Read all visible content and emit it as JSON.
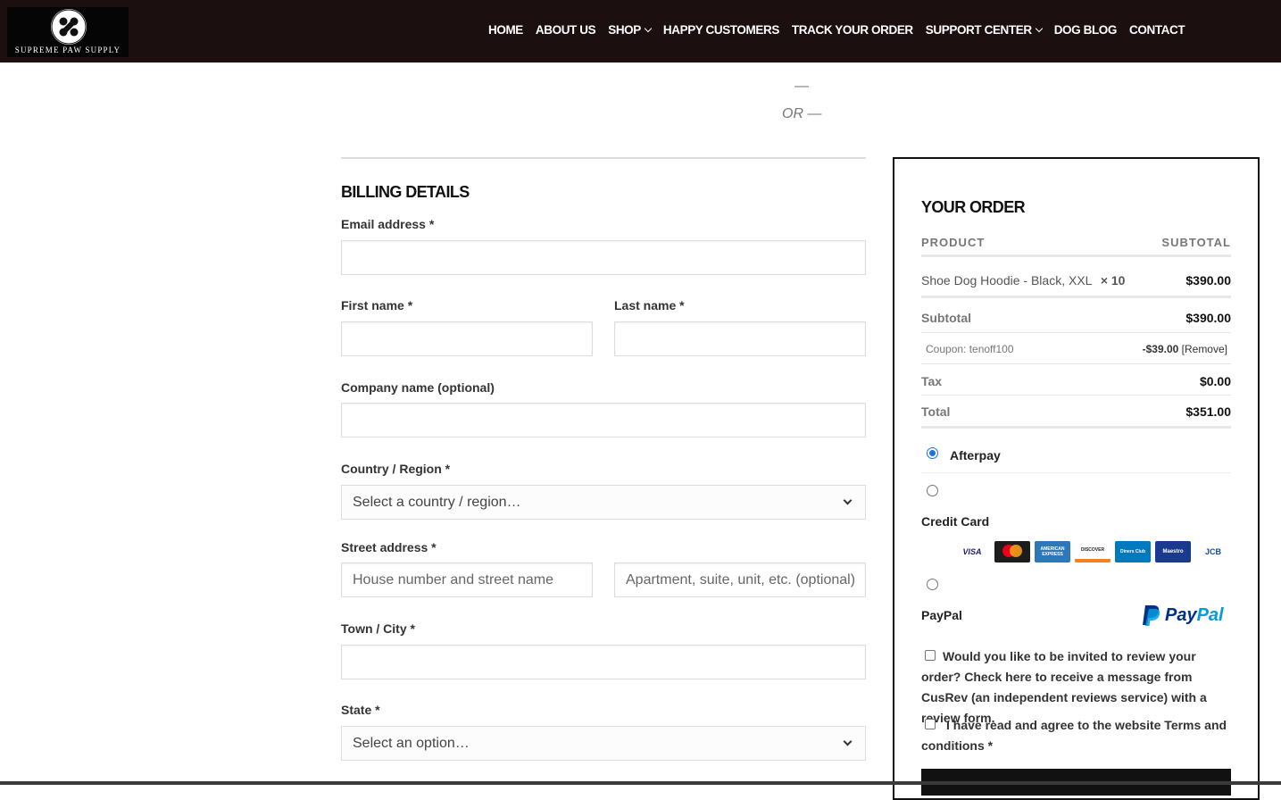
{
  "brand": {
    "name": "SUPREME PAW SUPPLY"
  },
  "nav": [
    {
      "label": "HOME",
      "dropdown": false
    },
    {
      "label": "ABOUT US",
      "dropdown": false
    },
    {
      "label": "SHOP",
      "dropdown": true
    },
    {
      "label": "HAPPY CUSTOMERS",
      "dropdown": false
    },
    {
      "label": "TRACK YOUR ORDER",
      "dropdown": false
    },
    {
      "label": "SUPPORT CENTER",
      "dropdown": true
    },
    {
      "label": "DOG BLOG",
      "dropdown": false
    },
    {
      "label": "CONTACT",
      "dropdown": false
    }
  ],
  "divider": {
    "dash": "—",
    "or": "OR —"
  },
  "billing": {
    "title": "BILLING DETAILS",
    "email_label": "Email address *",
    "first_name_label": "First name *",
    "last_name_label": "Last name *",
    "company_label": "Company name (optional)",
    "country_label": "Country / Region *",
    "country_value": "Select a country / region…",
    "street_label": "Street address *",
    "street_placeholder": "House number and street name",
    "street2_placeholder": "Apartment, suite, unit, etc. (optional)",
    "city_label": "Town / City *",
    "state_label": "State *",
    "state_value": "Select an option…"
  },
  "order": {
    "title": "YOUR ORDER",
    "col_product": "PRODUCT",
    "col_subtotal": "SUBTOTAL",
    "item_name": "Shoe Dog Hoodie - Black, XXL",
    "item_qty": "× 10",
    "item_price": "$390.00",
    "subtotal_label": "Subtotal",
    "subtotal_value": "$390.00",
    "coupon_label": "Coupon: tenoff100",
    "coupon_value": "-$39.00",
    "coupon_remove": "[Remove]",
    "tax_label": "Tax",
    "tax_value": "$0.00",
    "total_label": "Total",
    "total_value": "$351.00"
  },
  "payment": {
    "afterpay": "Afterpay",
    "credit_card": "Credit Card",
    "paypal": "PayPal",
    "paypal_logo_a": "Pay",
    "paypal_logo_b": "Pal",
    "cards": [
      "VISA",
      "mastercard",
      "AMERICAN EXPRESS",
      "DISCOVER",
      "Diners Club",
      "Maestro",
      "JCB"
    ]
  },
  "consent": {
    "review_text": "Would you like to be invited to review your order? Check here to receive a message from CusRev (an independent reviews service) with a review form.",
    "terms_text": "I have read and agree to the website Terms and conditions *"
  },
  "colors": {
    "header_bg": "#1c0f10",
    "radio_accent": "#1a73e8",
    "paypal_dark": "#003087",
    "paypal_light": "#009cde"
  }
}
